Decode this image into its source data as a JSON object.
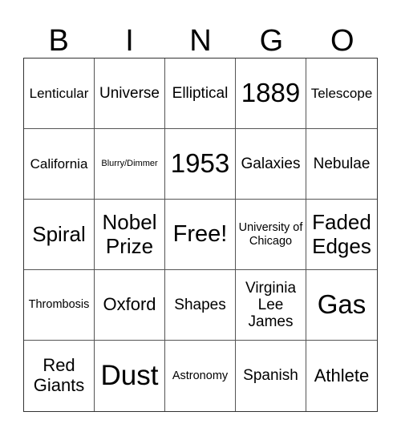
{
  "header": {
    "letters": [
      "B",
      "I",
      "N",
      "G",
      "O"
    ]
  },
  "cells": [
    "Lenticular",
    "Universe",
    "Elliptical",
    "1889",
    "Telescope",
    "California",
    "Blurry/Dimmer",
    "1953",
    "Galaxies",
    "Nebulae",
    "Spiral",
    "Nobel Prize",
    "Free!",
    "University of Chicago",
    "Faded Edges",
    "Thrombosis",
    "Oxford",
    "Shapes",
    "Virginia Lee James",
    "Gas",
    "Red Giants",
    "Dust",
    "Astronomy",
    "Spanish",
    "Athlete"
  ]
}
